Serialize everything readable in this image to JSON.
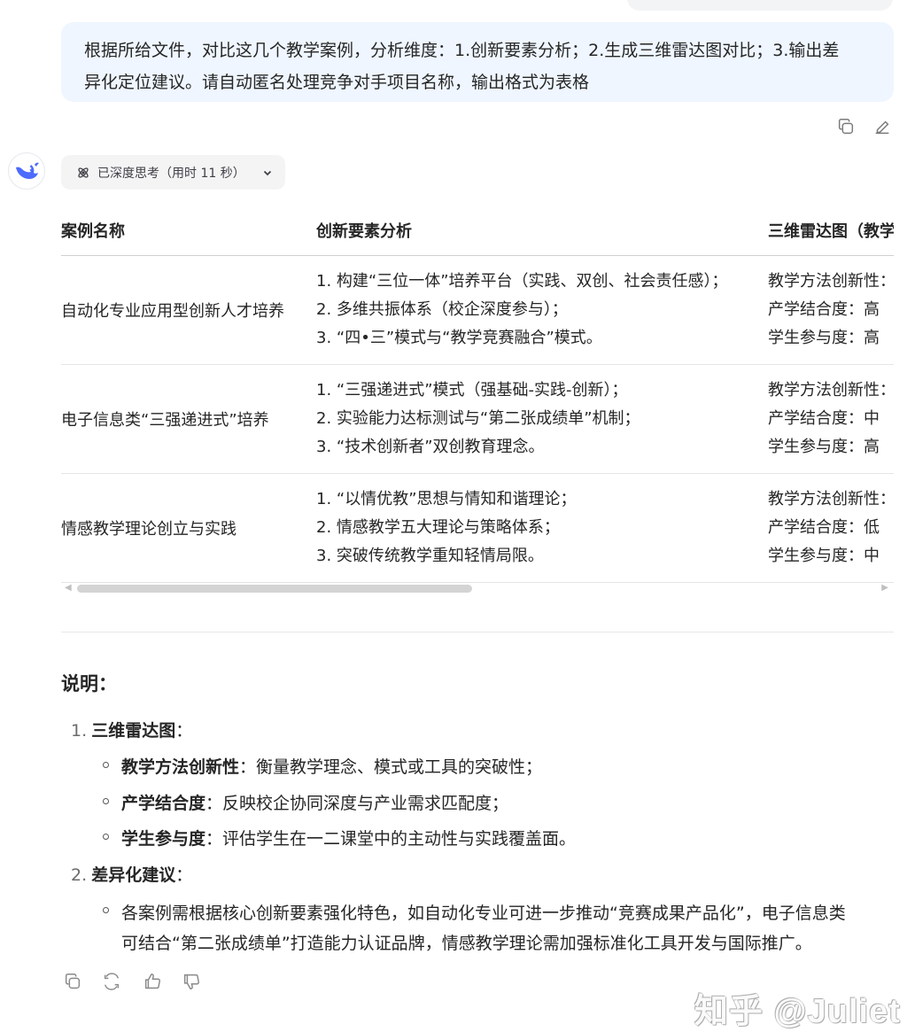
{
  "user_message": {
    "line1": "根据所给文件，对比这几个教学案例，分析维度：1.创新要素分析；2.生成三维雷达图对比；3.输出差",
    "line2": "异化定位建议。请自动匿名处理竞争对手项目名称，输出格式为表格"
  },
  "thinking": {
    "label": "已深度思考（用时 11 秒）"
  },
  "table": {
    "headers": [
      "案例名称",
      "创新要素分析",
      "三维雷达图（教学"
    ],
    "rows": [
      {
        "name": "自动化专业应用型创新人才培养",
        "elements": [
          "1. 构建“三位一体”培养平台（实践、双创、社会责任感）；",
          "2. 多维共振体系（校企深度参与）；",
          "3. “四•三”模式与“教学竞赛融合”模式。"
        ],
        "radar": [
          "教学方法创新性：",
          "产学结合度：高",
          "学生参与度：高"
        ]
      },
      {
        "name": "电子信息类“三强递进式”培养",
        "elements": [
          "1. “三强递进式”模式（强基础-实践-创新）；",
          "2. 实验能力达标测试与“第二张成绩单”机制；",
          "3. “技术创新者”双创教育理念。"
        ],
        "radar": [
          "教学方法创新性：",
          "产学结合度：中",
          "学生参与度：高"
        ]
      },
      {
        "name": "情感教学理论创立与实践",
        "elements": [
          "1. “以情优教”思想与情知和谐理论；",
          "2. 情感教学五大理论与策略体系；",
          "3. 突破传统教学重知轻情局限。"
        ],
        "radar": [
          "教学方法创新性：",
          "产学结合度：低",
          "学生参与度：中"
        ]
      }
    ]
  },
  "notes": {
    "heading": "说明：",
    "item1": {
      "num": "1.",
      "title": "三维雷达图",
      "colon": "：",
      "subs": [
        {
          "bold": "教学方法创新性",
          "text": "：衡量教学理念、模式或工具的突破性；"
        },
        {
          "bold": "产学结合度",
          "text": "：反映校企协同深度与产业需求匹配度；"
        },
        {
          "bold": "学生参与度",
          "text": "：评估学生在一二课堂中的主动性与实践覆盖面。"
        }
      ]
    },
    "item2": {
      "num": "2.",
      "title": "差异化建议",
      "colon": "：",
      "line1": "各案例需根据核心创新要素强化特色，如自动化专业可进一步推动“竞赛成果产品化”，电子信息类",
      "line2": "可结合“第二张成绩单”打造能力认证品牌，情感教学理论需加强标准化工具开发与国际推广。"
    }
  },
  "watermark": "知乎 @Juliet",
  "icons": [
    "copy-icon",
    "edit-icon",
    "deepseek-logo-icon",
    "deep-think-icon",
    "chevron-down-icon",
    "regenerate-icon",
    "thumbs-up-icon",
    "thumbs-down-icon"
  ]
}
